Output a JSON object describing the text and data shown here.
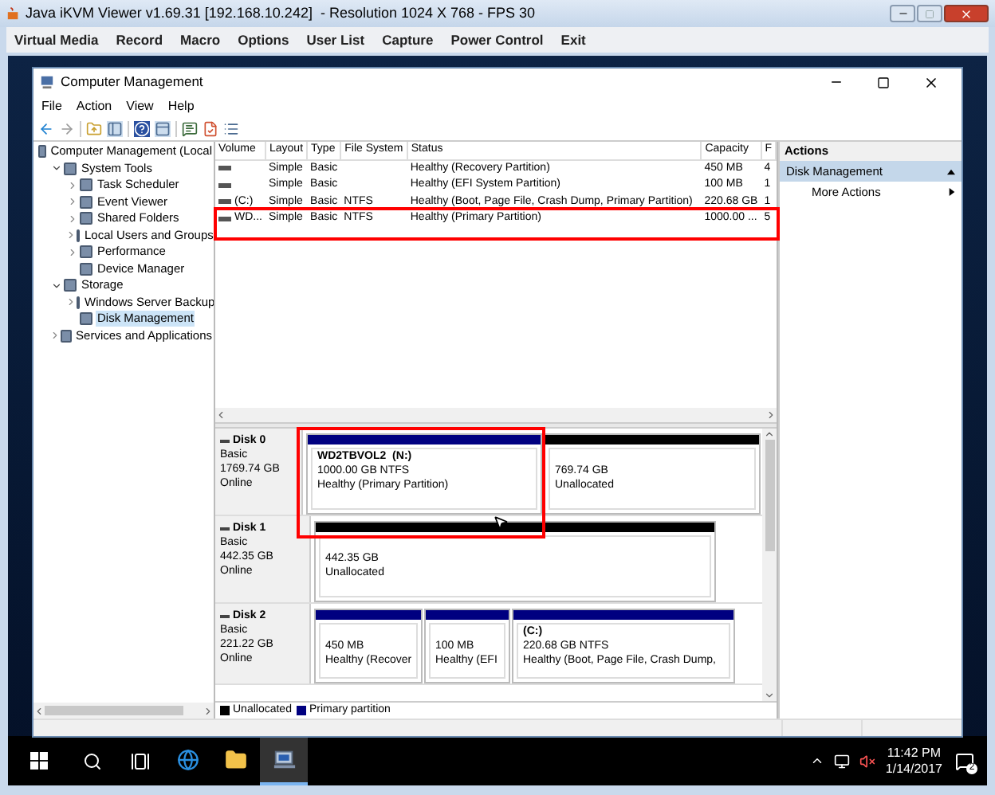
{
  "viewer": {
    "title": "Java iKVM Viewer v1.69.31 [192.168.10.242]  - Resolution 1024 X 768 - FPS 30",
    "menu": [
      "Virtual Media",
      "Record",
      "Macro",
      "Options",
      "User List",
      "Capture",
      "Power Control",
      "Exit"
    ]
  },
  "window": {
    "title": "Computer Management",
    "menu": [
      "File",
      "Action",
      "View",
      "Help"
    ]
  },
  "tree": [
    {
      "label": "Computer Management (Local",
      "selected": false,
      "children": [
        {
          "label": "System Tools",
          "expanded": true,
          "selected": false,
          "children": [
            {
              "label": "Task Scheduler",
              "expanded": false,
              "selected": false
            },
            {
              "label": "Event Viewer",
              "expanded": false,
              "selected": false
            },
            {
              "label": "Shared Folders",
              "expanded": false,
              "selected": false
            },
            {
              "label": "Local Users and Groups",
              "expanded": false,
              "selected": false
            },
            {
              "label": "Performance",
              "expanded": false,
              "selected": false
            },
            {
              "label": "Device Manager",
              "selected": false
            }
          ]
        },
        {
          "label": "Storage",
          "expanded": true,
          "selected": false,
          "children": [
            {
              "label": "Windows Server Backup",
              "expanded": false,
              "selected": false
            },
            {
              "label": "Disk Management",
              "selected": true
            }
          ]
        },
        {
          "label": "Services and Applications",
          "expanded": false,
          "selected": false
        }
      ]
    }
  ],
  "table": {
    "columns": [
      "Volume",
      "Layout",
      "Type",
      "File System",
      "Status",
      "Capacity",
      "F"
    ],
    "rows": [
      {
        "layout": "Simple",
        "type": "Basic",
        "status": "Healthy (Recovery Partition)",
        "capacity": "450 MB",
        "column_7": "4"
      },
      {
        "layout": "Simple",
        "type": "Basic",
        "status": "Healthy (EFI System Partition)",
        "capacity": "100 MB",
        "column_7": "1"
      },
      {
        "volume": "(C:)",
        "layout": "Simple",
        "type": "Basic",
        "file_system": "NTFS",
        "status": "Healthy (Boot, Page File, Crash Dump, Primary Partition)",
        "capacity": "220.68 GB",
        "column_7": "1"
      },
      {
        "volume": "WD...",
        "layout": "Simple",
        "type": "Basic",
        "file_system": "NTFS",
        "status": "Healthy (Primary Partition)",
        "capacity": "1000.00 ...",
        "column_7": "5"
      }
    ]
  },
  "disks": [
    {
      "name": "Disk 0",
      "type": "Basic",
      "size": "1769.74 GB",
      "status": "Online",
      "partitions": [
        {
          "kind": "primary",
          "name": "WD2TBVOL2  (N:)",
          "lines": [
            "1000.00 GB NTFS",
            "Healthy (Primary Partition)"
          ]
        },
        {
          "kind": "unallocated",
          "lines": [
            "769.74 GB",
            "Unallocated"
          ]
        }
      ]
    },
    {
      "name": "Disk 1",
      "type": "Basic",
      "size": "442.35 GB",
      "status": "Online",
      "partitions": [
        {
          "kind": "unallocated",
          "lines": [
            "442.35 GB",
            "Unallocated"
          ]
        }
      ]
    },
    {
      "name": "Disk 2",
      "type": "Basic",
      "size": "221.22 GB",
      "status": "Online",
      "partitions": [
        {
          "kind": "primary",
          "lines": [
            "450 MB",
            "Healthy (Recover"
          ]
        },
        {
          "kind": "primary",
          "lines": [
            "100 MB",
            "Healthy (EFI"
          ]
        },
        {
          "kind": "primary",
          "name": "(C:)",
          "lines": [
            "220.68 GB NTFS",
            "Healthy (Boot, Page File, Crash Dump,"
          ]
        }
      ]
    }
  ],
  "legend": [
    {
      "label": "Unallocated",
      "color": "#000000"
    },
    {
      "label": "Primary partition",
      "color": "#000080"
    }
  ],
  "actions": {
    "title": "Actions",
    "section": "Disk Management",
    "items": [
      "More Actions"
    ]
  },
  "taskbar": {
    "pinned": [
      {
        "kind": "browser",
        "selected": false
      },
      {
        "kind": "folder",
        "selected": false
      },
      {
        "kind": "management",
        "selected": true
      }
    ],
    "time": "11:42 PM",
    "date": "1/14/2017",
    "notifications": "2"
  }
}
